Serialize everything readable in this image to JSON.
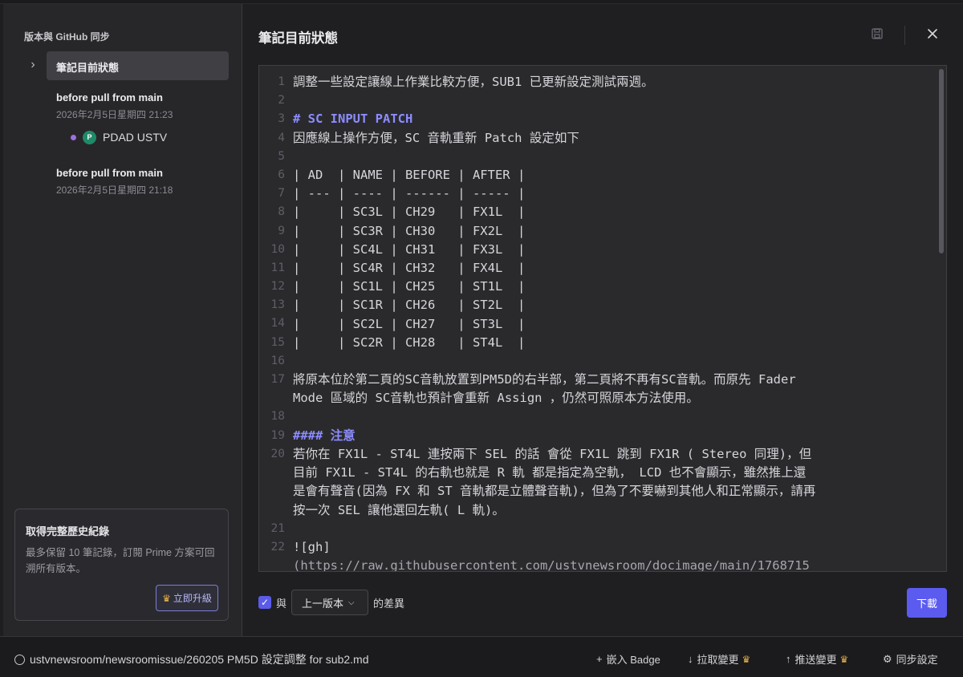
{
  "sidebar": {
    "title": "版本與 GitHub 同步",
    "current_version": "筆記目前狀態",
    "versions": [
      {
        "title": "before pull from main",
        "date": "2026年2月5日星期四 21:23",
        "author_initial": "P",
        "author": "PDAD USTV"
      },
      {
        "title": "before pull from main",
        "date": "2026年2月5日星期四 21:18"
      }
    ],
    "promo": {
      "heading": "取得完整歷史紀錄",
      "body": "最多保留 10 筆記錄，訂閱 Prime 方案可回溯所有版本。",
      "button": "立即升級"
    }
  },
  "main": {
    "title": "筆記目前狀態",
    "line_numbers": [
      "1",
      "2",
      "3",
      "4",
      "5",
      "6",
      "7",
      "8",
      "9",
      "10",
      "11",
      "12",
      "13",
      "14",
      "15",
      "16",
      "17",
      "",
      "18",
      "19",
      "20",
      "",
      "",
      "",
      "21",
      "22"
    ],
    "lines": [
      {
        "text": "調整一些設定讓線上作業比較方便，SUB1 已更新設定測試兩週。",
        "kind": "text"
      },
      {
        "text": "",
        "kind": "text"
      },
      {
        "text": "# SC INPUT PATCH",
        "kind": "heading"
      },
      {
        "text": "因應線上操作方便，SC 音軌重新 Patch 設定如下",
        "kind": "text"
      },
      {
        "text": "",
        "kind": "text"
      },
      {
        "text": "| AD  | NAME | BEFORE | AFTER |",
        "kind": "text"
      },
      {
        "text": "| --- | ---- | ------ | ----- |",
        "kind": "text"
      },
      {
        "text": "|     | SC3L | CH29   | FX1L  |",
        "kind": "text"
      },
      {
        "text": "|     | SC3R | CH30   | FX2L  |",
        "kind": "text"
      },
      {
        "text": "|     | SC4L | CH31   | FX3L  |",
        "kind": "text"
      },
      {
        "text": "|     | SC4R | CH32   | FX4L  |",
        "kind": "text"
      },
      {
        "text": "|     | SC1L | CH25   | ST1L  |",
        "kind": "text"
      },
      {
        "text": "|     | SC1R | CH26   | ST2L  |",
        "kind": "text"
      },
      {
        "text": "|     | SC2L | CH27   | ST3L  |",
        "kind": "text"
      },
      {
        "text": "|     | SC2R | CH28   | ST4L  |",
        "kind": "text"
      },
      {
        "text": "",
        "kind": "text"
      },
      {
        "text": "將原本位於第二頁的SC音軌放置到PM5D的右半部，第二頁將不再有SC音軌。而原先 Fader",
        "kind": "text"
      },
      {
        "text": "Mode 區域的 SC音軌也預計會重新 Assign ，仍然可照原本方法使用。",
        "kind": "text"
      },
      {
        "text": "",
        "kind": "text"
      },
      {
        "text": "#### 注意",
        "kind": "heading"
      },
      {
        "text": "若你在 FX1L - ST4L 連按兩下 SEL 的話 會從 FX1L 跳到 FX1R ( Stereo 同理)，但",
        "kind": "text"
      },
      {
        "text": "目前 FX1L - ST4L 的右軌也就是 R 軌 都是指定為空軌， LCD 也不會顯示，雖然推上還",
        "kind": "text"
      },
      {
        "text": "是會有聲音(因為 FX 和 ST 音軌都是立體聲音軌)，但為了不要嚇到其他人和正常顯示，請再",
        "kind": "text"
      },
      {
        "text": "按一次 SEL 讓他選回左軌( L 軌)。",
        "kind": "text"
      },
      {
        "text": "",
        "kind": "text"
      },
      {
        "text": "![gh]",
        "kind": "text"
      },
      {
        "text": "(https://raw.githubusercontent.com/ustvnewsroom/docimage/main/1768715",
        "kind": "link"
      }
    ],
    "diff": {
      "prefix": "與",
      "selected": "上一版本",
      "suffix": "的差異",
      "checked": true
    },
    "download_label": "下載"
  },
  "statusbar": {
    "repo": "ustvnewsroom/newsroomissue/260205 PM5D 設定調整 for sub2.md",
    "embed_badge": "嵌入 Badge",
    "pull": "拉取變更",
    "push": "推送變更",
    "sync_settings": "同步設定"
  }
}
